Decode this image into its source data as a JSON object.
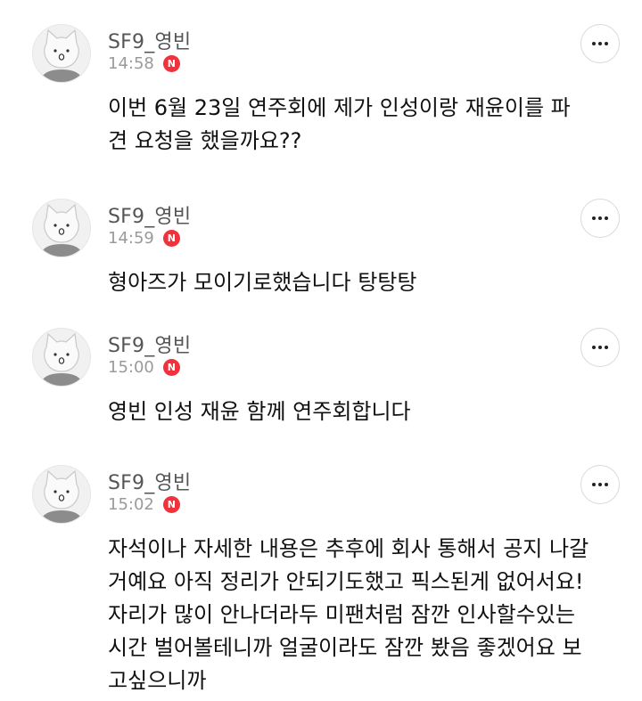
{
  "comments": [
    {
      "username": "SF9_영빈",
      "time": "14:58",
      "badge": "N",
      "body": "이번 6월 23일 연주회에 제가 인성이랑 재윤이를 파\n견 요청을 했을까요??"
    },
    {
      "username": "SF9_영빈",
      "time": "14:59",
      "badge": "N",
      "body": "형아즈가 모이기로했습니다 탕탕탕"
    },
    {
      "username": "SF9_영빈",
      "time": "15:00",
      "badge": "N",
      "body": "영빈 인성 재윤 함께 연주회합니다"
    },
    {
      "username": "SF9_영빈",
      "time": "15:02",
      "badge": "N",
      "body": "자석이나 자세한 내용은 추후에 회사 통해서 공지 나갈\n거예요 아직 정리가 안되기도했고 픽스된게 없어서요!\n자리가 많이 안나더라두 미팬처럼 잠깐 인사할수있는\n시간 벌어볼테니까 얼굴이라도 잠깐 봤음 좋겠어요 보\n고싶으니까"
    }
  ],
  "colors": {
    "badge": "#f0323c",
    "username": "#555555",
    "time": "#9a9a9a",
    "text": "#111111"
  },
  "icons": {
    "avatar": "cat-avatar-icon",
    "more": "more-options-icon"
  }
}
